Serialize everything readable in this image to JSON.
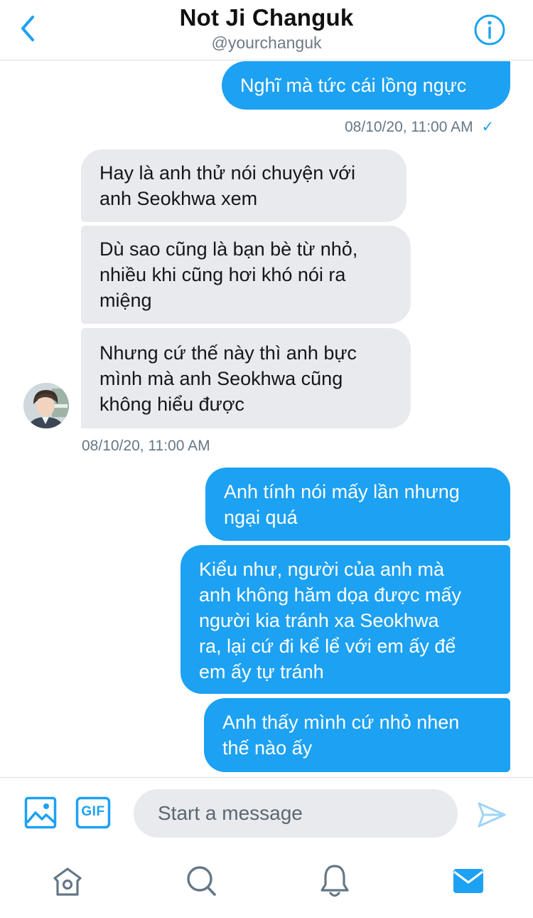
{
  "header": {
    "title": "Not Ji Changuk",
    "handle": "@yourchanguk",
    "back_icon": "chevron-left-icon",
    "info_icon": "info-circle-icon"
  },
  "messages": [
    {
      "side": "outgoing",
      "text": [
        "Nghĩ mà tức cái lồng ngực"
      ]
    },
    {
      "side": "incoming",
      "text": [
        "Hay là anh thử nói chuyện với",
        "anh Seokhwa xem"
      ]
    },
    {
      "side": "incoming",
      "text": [
        "Dù sao cũng là bạn bè từ nhỏ,",
        "nhiều khi cũng hơi khó nói ra",
        "miệng"
      ]
    },
    {
      "side": "incoming",
      "text": [
        "Nhưng cứ thế này thì anh bực",
        "mình mà anh Seokhwa cũng",
        "không hiểu được"
      ]
    },
    {
      "side": "outgoing",
      "text": [
        "Anh tính nói mấy lần nhưng",
        "ngại quá"
      ]
    },
    {
      "side": "outgoing",
      "text": [
        "Kiểu như, người của anh mà",
        "anh không hăm dọa được mấy",
        "người kia tránh xa Seokhwa",
        "ra, lại cứ đi kể lể với em ấy để",
        "em ấy tự tránh"
      ]
    },
    {
      "side": "outgoing",
      "text": [
        "Anh thấy mình cứ nhỏ nhen",
        "thế nào ấy"
      ]
    }
  ],
  "timestamps": {
    "sent": "08/10/20, 11:00 AM",
    "sent_status": "✓",
    "received": "08/10/20, 11:00 AM"
  },
  "composer": {
    "placeholder": "Start a message",
    "gif_label": "GIF",
    "image_icon": "image-icon",
    "send_icon": "send-icon"
  },
  "tabs": [
    {
      "name": "home",
      "icon": "home-icon",
      "active": false
    },
    {
      "name": "search",
      "icon": "search-icon",
      "active": false
    },
    {
      "name": "notifications",
      "icon": "bell-icon",
      "active": false
    },
    {
      "name": "messages",
      "icon": "mail-icon",
      "active": true
    }
  ],
  "colors": {
    "accent": "#1da1f2",
    "incoming_bubble": "#e8eaed",
    "muted_text": "#657786",
    "tab_icon": "#657786"
  }
}
